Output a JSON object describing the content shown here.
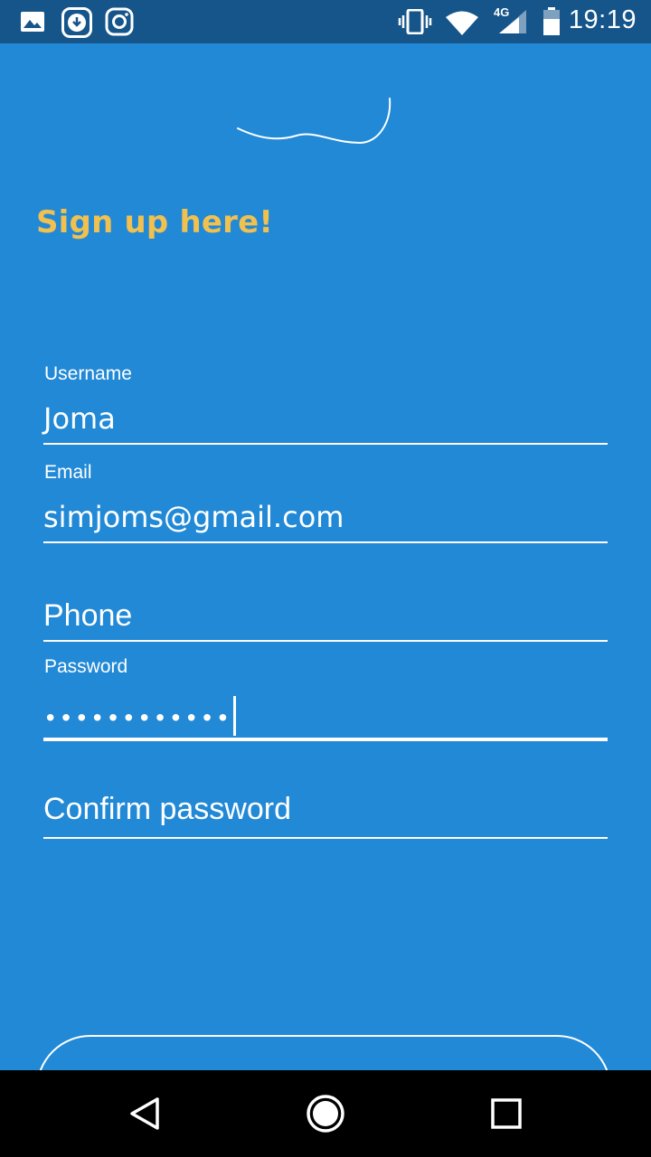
{
  "status_bar": {
    "time": "19:19",
    "network": "4G",
    "icons": [
      "image-icon",
      "download-icon",
      "instagram-icon",
      "vibrate-icon",
      "wifi-icon",
      "signal-icon",
      "battery-icon"
    ]
  },
  "form": {
    "title": "Sign up here!",
    "username": {
      "label": "Username",
      "value": "Joma"
    },
    "email": {
      "label": "Email",
      "value": "simjoms@gmail.com"
    },
    "phone": {
      "placeholder": "Phone"
    },
    "password": {
      "label": "Password",
      "masked_value": "••••••••••••"
    },
    "confirm_password": {
      "placeholder": "Confirm password"
    },
    "submit_label": ""
  },
  "nav_bar": {
    "icons": [
      "back-icon",
      "home-icon",
      "recents-icon"
    ]
  },
  "colors": {
    "background": "#2289d6",
    "status_bar": "#15558a",
    "title": "#f0c050",
    "text": "#ffffff",
    "nav_bar": "#000000"
  }
}
